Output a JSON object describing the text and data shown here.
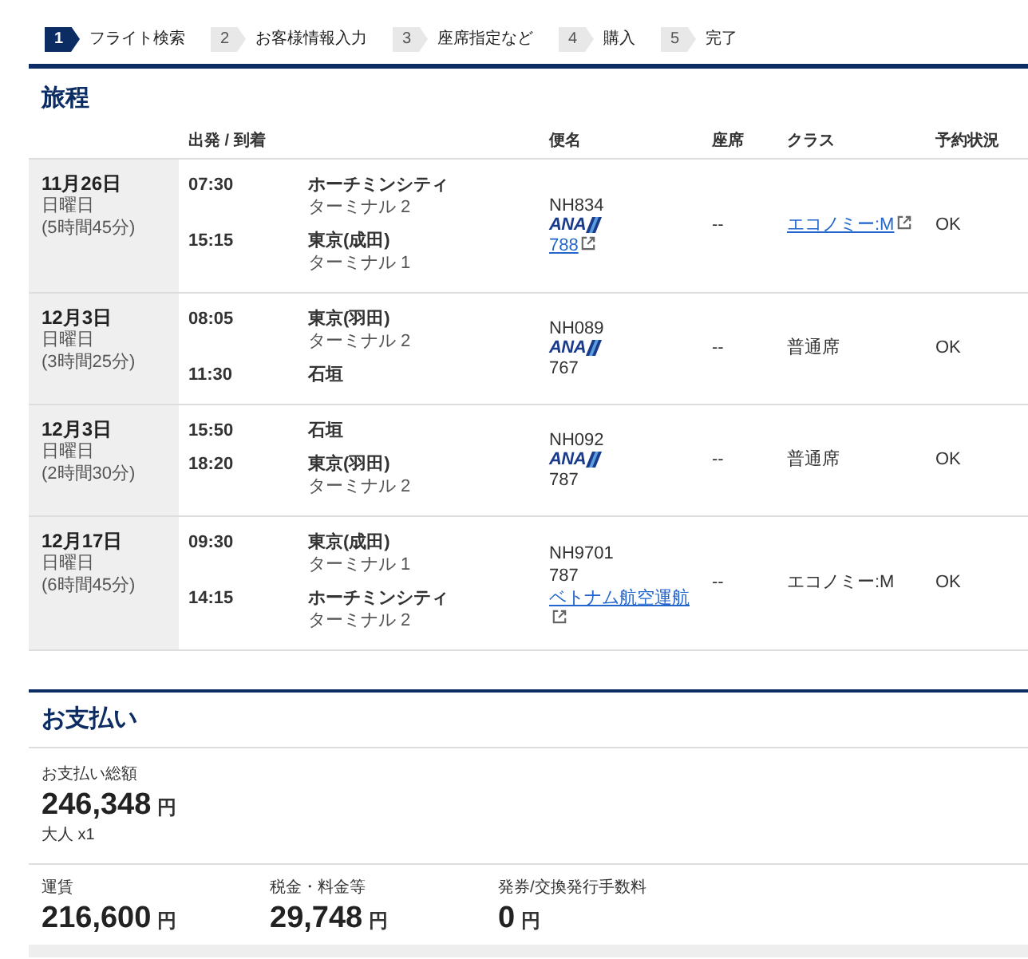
{
  "steps": [
    {
      "number": "1",
      "label": "フライト検索",
      "selected": true
    },
    {
      "number": "2",
      "label": "お客様情報入力",
      "selected": false
    },
    {
      "number": "3",
      "label": "座席指定など",
      "selected": false
    },
    {
      "number": "4",
      "label": "購入",
      "selected": false
    },
    {
      "number": "5",
      "label": "完了",
      "selected": false
    }
  ],
  "itinerary": {
    "title": "旅程",
    "columns": [
      "出発 / 到着",
      "便名",
      "座席",
      "クラス",
      "予約状況"
    ],
    "rows": [
      {
        "date": "11月26日",
        "weekday": "日曜日",
        "duration": "(5時間45分)",
        "departure": {
          "time": "07:30",
          "place": "ホーチミンシティ",
          "terminal": "ターミナル 2"
        },
        "arrival": {
          "time": "15:15",
          "place": "東京(成田)",
          "terminal": "ターミナル 1"
        },
        "flight": "NH834",
        "airline_logo": "ANA",
        "aircraft": "788",
        "aircraft_link": true,
        "seat": "--",
        "class": "エコノミー:M",
        "class_link": true,
        "status": "OK"
      },
      {
        "date": "12月3日",
        "weekday": "日曜日",
        "duration": "(3時間25分)",
        "departure": {
          "time": "08:05",
          "place": "東京(羽田)",
          "terminal": "ターミナル 2"
        },
        "arrival": {
          "time": "11:30",
          "place": "石垣"
        },
        "flight": "NH089",
        "airline_logo": "ANA",
        "aircraft": "767",
        "aircraft_link": false,
        "seat": "--",
        "class": "普通席",
        "class_link": false,
        "status": "OK"
      },
      {
        "date": "12月3日",
        "weekday": "日曜日",
        "duration": "(2時間30分)",
        "departure": {
          "time": "15:50",
          "place": "石垣"
        },
        "arrival": {
          "time": "18:20",
          "place": "東京(羽田)",
          "terminal": "ターミナル 2"
        },
        "flight": "NH092",
        "airline_logo": "ANA",
        "aircraft": "787",
        "aircraft_link": false,
        "seat": "--",
        "class": "普通席",
        "class_link": false,
        "status": "OK"
      },
      {
        "date": "12月17日",
        "weekday": "日曜日",
        "duration": "(6時間45分)",
        "departure": {
          "time": "09:30",
          "place": "東京(成田)",
          "terminal": "ターミナル 1"
        },
        "arrival": {
          "time": "14:15",
          "place": "ホーチミンシティ",
          "terminal": "ターミナル 2"
        },
        "flight": "NH9701",
        "aircraft": "787",
        "aircraft_link": false,
        "operator": "ベトナム航空運航",
        "seat": "--",
        "class": "エコノミー:M",
        "class_link": false,
        "status": "OK"
      }
    ]
  },
  "payment": {
    "title": "お支払い",
    "total_label": "お支払い総額",
    "total": "246,348",
    "total_currency": "円",
    "passengers": "大人 x1",
    "breakdown": [
      {
        "label": "運賃",
        "amount": "216,600",
        "currency": "円"
      },
      {
        "label": "税金・料金等",
        "amount": "29,748",
        "currency": "円"
      },
      {
        "label": "発券/交換発行手数料",
        "amount": "0",
        "currency": "円"
      }
    ]
  }
}
